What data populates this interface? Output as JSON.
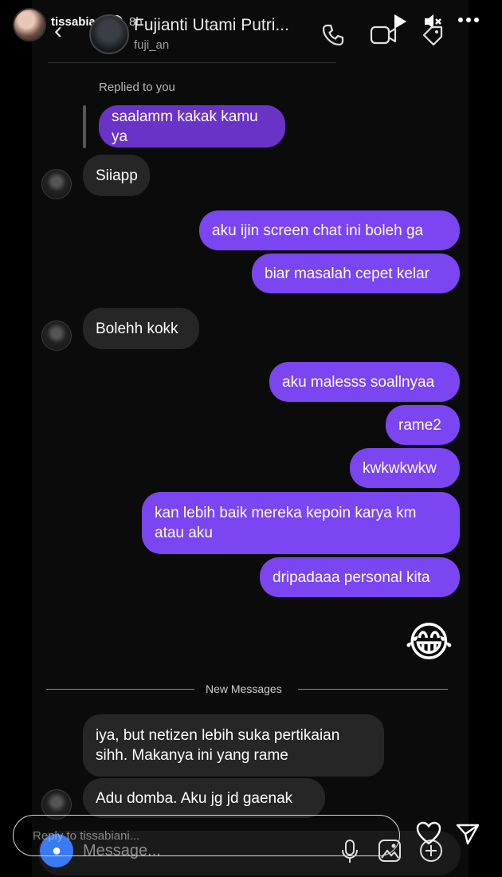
{
  "story": {
    "username": "tissabiani",
    "time": "8h",
    "verified": "✓",
    "reply_placeholder": "Reply to tissabiani..."
  },
  "dm": {
    "contact_name": "Fujianti Utami Putri...",
    "contact_handle": "fuji_an",
    "replied_label": "Replied to you",
    "quoted": "saalamm kakak kamu ya",
    "new_messages_label": "New Messages",
    "emoji": "😂",
    "composer_placeholder": "Message..."
  },
  "messages": [
    {
      "from": "them",
      "text": "Siiapp"
    },
    {
      "from": "me",
      "text": "aku ijin screen chat ini boleh ga"
    },
    {
      "from": "me",
      "text": "biar masalah cepet kelar"
    },
    {
      "from": "them",
      "text": "Bolehh kokk"
    },
    {
      "from": "me",
      "text": "aku malesss soallnyaa"
    },
    {
      "from": "me",
      "text": "rame2"
    },
    {
      "from": "me",
      "text": "kwkwkwkw"
    },
    {
      "from": "me",
      "text": "kan lebih baik mereka kepoin karya km atau aku"
    },
    {
      "from": "me",
      "text": "dripadaaa personal kita"
    },
    {
      "from": "them",
      "text": "iya, but netizen lebih suka pertikaian sihh. Makanya ini yang rame"
    },
    {
      "from": "them",
      "text": "Adu domba. Aku jg jd gaenak"
    }
  ],
  "colors": {
    "outgoing_bubble": "#7b45f2",
    "incoming_bubble": "#262626",
    "quoted_bubble": "#6a33c8",
    "camera_button": "#3a7bf3"
  }
}
